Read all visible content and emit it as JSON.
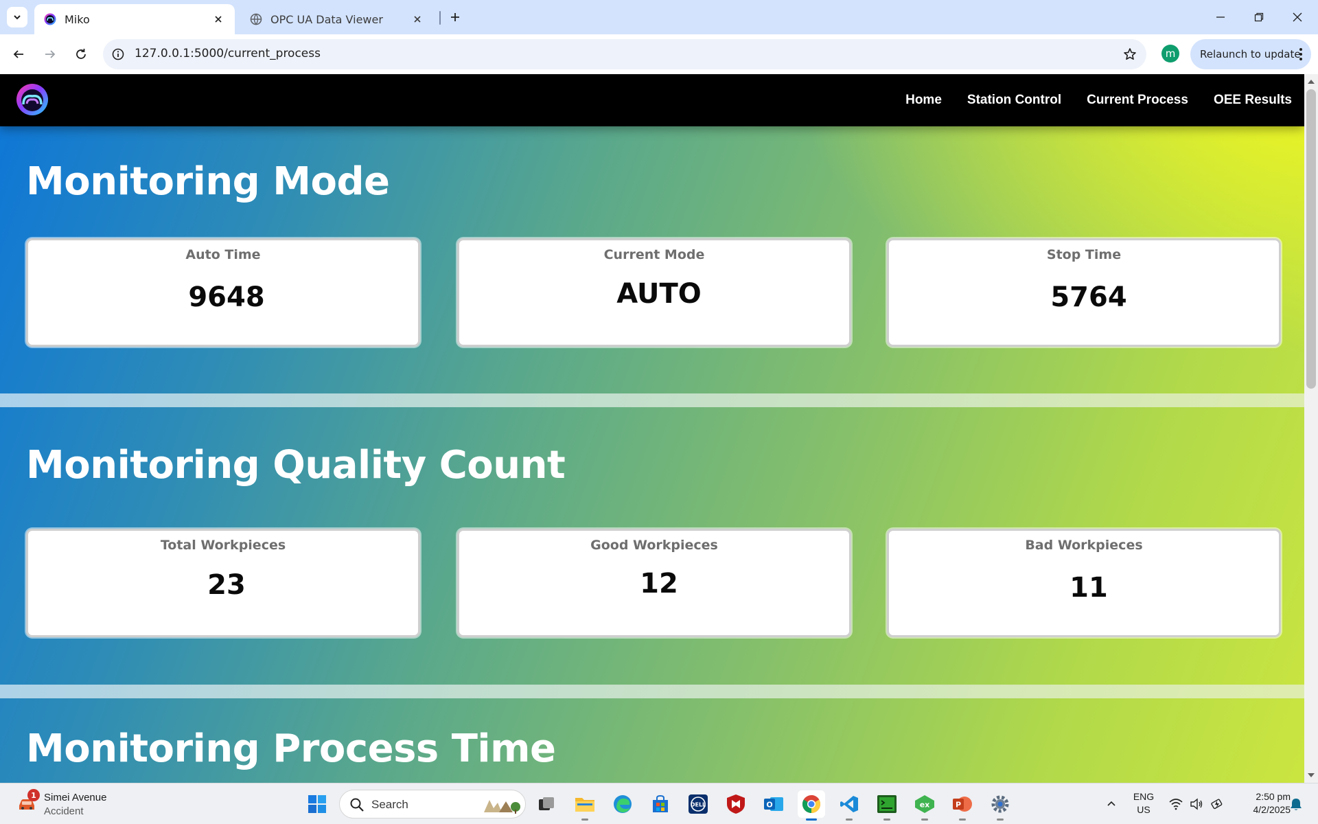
{
  "browser": {
    "tabs": [
      {
        "title": "Miko",
        "active": true
      },
      {
        "title": "OPC UA Data Viewer",
        "active": false
      }
    ],
    "url": "127.0.0.1:5000/current_process",
    "profile_initial": "m",
    "relaunch_label": "Relaunch to update"
  },
  "nav": {
    "links": [
      "Home",
      "Station Control",
      "Current Process",
      "OEE Results"
    ]
  },
  "sections": {
    "mode": {
      "title": "Monitoring Mode",
      "cards": [
        {
          "label": "Auto Time",
          "value": "9648"
        },
        {
          "label": "Current Mode",
          "value": "AUTO"
        },
        {
          "label": "Stop Time",
          "value": "5764"
        }
      ]
    },
    "quality": {
      "title": "Monitoring Quality Count",
      "cards": [
        {
          "label": "Total Workpieces",
          "value": "23"
        },
        {
          "label": "Good Workpieces",
          "value": "12"
        },
        {
          "label": "Bad Workpieces",
          "value": "11"
        }
      ]
    },
    "process_time": {
      "title": "Monitoring Process Time"
    }
  },
  "taskbar": {
    "weather": {
      "title": "Simei Avenue",
      "subtitle": "Accident",
      "badge": "1"
    },
    "search_placeholder": "Search",
    "language": {
      "line1": "ENG",
      "line2": "US"
    },
    "clock": {
      "time": "2:50 pm",
      "date": "4/2/2025"
    }
  },
  "colors": {
    "page_gradient_start": "#0d76d8",
    "page_gradient_end": "#cce63f",
    "nav_background": "#000000",
    "tab_strip": "#d3e3fd"
  }
}
